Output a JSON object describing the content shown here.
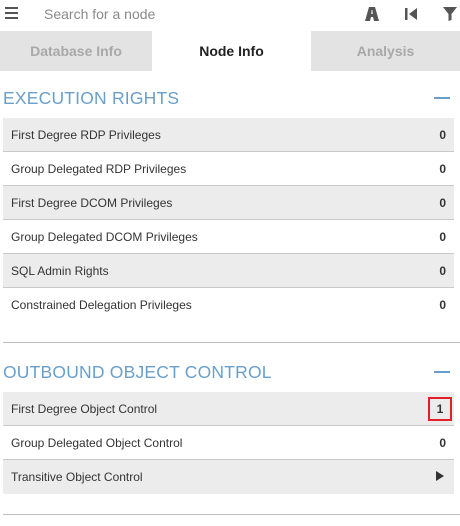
{
  "search": {
    "placeholder": "Search for a node"
  },
  "toolbar": {
    "icons": [
      "menu-icon",
      "pathfinding-icon",
      "back-icon",
      "filter-icon"
    ]
  },
  "tabs": [
    {
      "label": "Database Info",
      "active": false
    },
    {
      "label": "Node Info",
      "active": true
    },
    {
      "label": "Analysis",
      "active": false
    }
  ],
  "sections": {
    "execution_rights": {
      "title": "EXECUTION RIGHTS",
      "rows": [
        {
          "label": "First Degree RDP Privileges",
          "value": "0"
        },
        {
          "label": "Group Delegated RDP Privileges",
          "value": "0"
        },
        {
          "label": "First Degree DCOM Privileges",
          "value": "0"
        },
        {
          "label": "Group Delegated DCOM Privileges",
          "value": "0"
        },
        {
          "label": "SQL Admin Rights",
          "value": "0"
        },
        {
          "label": "Constrained Delegation Privileges",
          "value": "0"
        }
      ]
    },
    "outbound_control": {
      "title": "OUTBOUND OBJECT CONTROL",
      "rows": [
        {
          "label": "First Degree Object Control",
          "value": "1"
        },
        {
          "label": "Group Delegated Object Control",
          "value": "0"
        },
        {
          "label": "Transitive Object Control",
          "value": ""
        }
      ]
    }
  },
  "colors": {
    "accent": "#6a9fc9",
    "highlight_border": "#e0202a",
    "row_shade": "#ececec",
    "tab_inactive": "#e3e3e3"
  }
}
